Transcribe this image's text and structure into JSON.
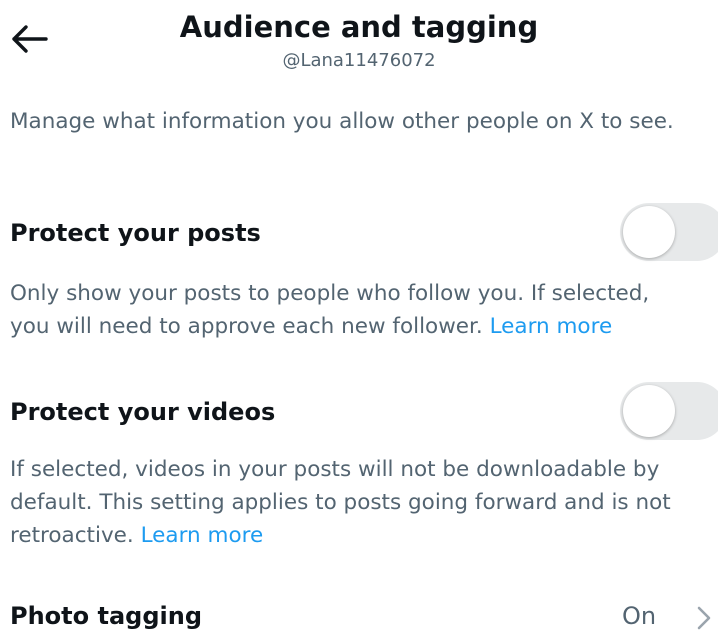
{
  "header": {
    "back_icon": "arrow-left-icon",
    "title": "Audience and tagging",
    "handle": "@Lana11476072"
  },
  "intro": "Manage what information you allow other people on X to see.",
  "protect_posts": {
    "title": "Protect your posts",
    "toggle_on": false,
    "desc_line1": "Only show your posts to people who follow you. If selected,",
    "desc_line2": "you will need to approve each new follower. ",
    "link": "Learn more"
  },
  "protect_videos": {
    "title": "Protect your videos",
    "toggle_on": false,
    "desc_line1": "If selected, videos in your posts will not be downloadable by",
    "desc_line2": "default. This setting applies to posts going forward and is not",
    "desc_line3": "retroactive. ",
    "link": "Learn more"
  },
  "photo_tagging": {
    "title": "Photo tagging",
    "value": "On",
    "chevron_icon": "chevron-right-icon"
  },
  "colors": {
    "text_primary": "#0f1419",
    "text_secondary": "#536471",
    "link": "#1d9bf0",
    "toggle_off_track": "#e7e9ea"
  }
}
